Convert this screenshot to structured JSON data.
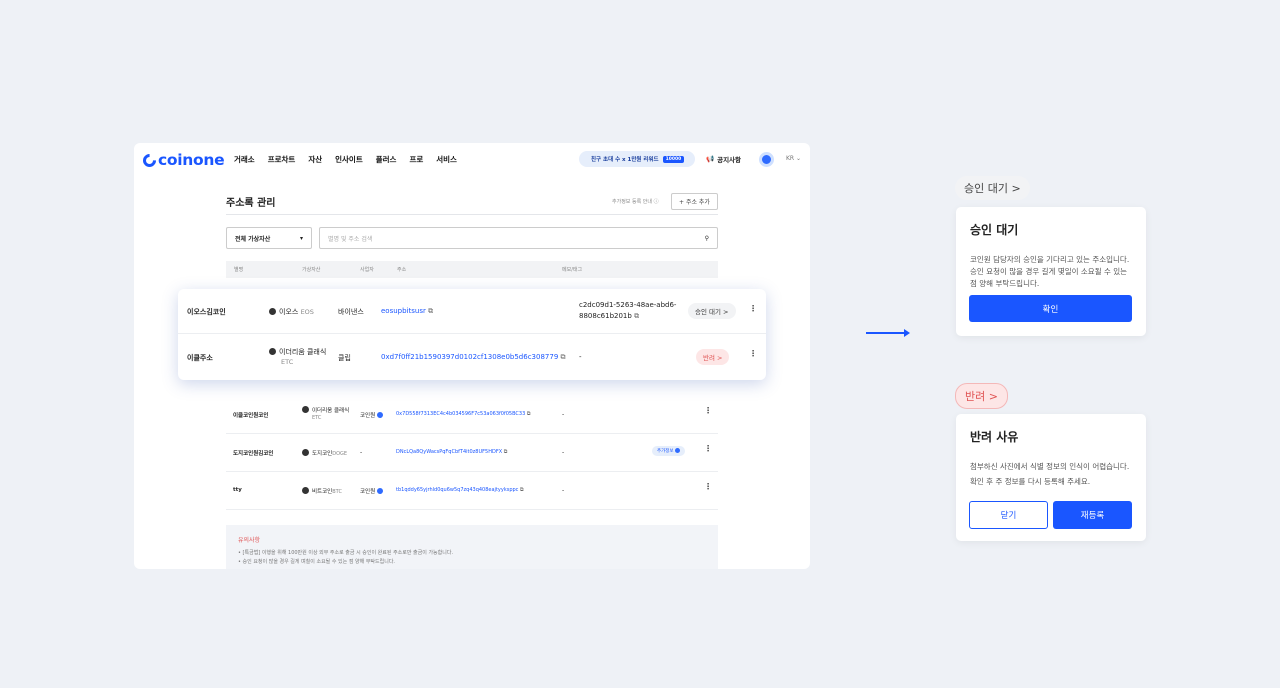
{
  "nav": {
    "brand": "coinone",
    "items": [
      "거래소",
      "프로차트",
      "자산",
      "인사이트",
      "플러스",
      "프로",
      "서비스"
    ],
    "promo": "친구 초대 수 x 1만원 리워드",
    "promo_chip": "10000",
    "notice": "공지사항",
    "lang": "KR"
  },
  "page": {
    "title": "주소록 관리",
    "info": "추가정보 등록 안내",
    "add_button": "+ 주소 추가",
    "filter": "전체 가상자산",
    "search_placeholder": "별명 및 주소 검색",
    "headers": [
      "별명",
      "가상자산",
      "사업자",
      "주소",
      "메모/태그"
    ]
  },
  "highlight_rows": [
    {
      "nickname": "이오스김코인",
      "asset": "이오스",
      "ticker": "EOS",
      "exchange": "바이낸스",
      "address_main": "eosupbits",
      "address_tail": "usr",
      "memo": "c2dc09d1-5263-48ae-abd6-",
      "memo2": "8808c61b201b",
      "status": "승인 대기 >"
    },
    {
      "nickname": "이클주소",
      "asset": "이더리움 클래식",
      "ticker": "ETC",
      "exchange": "클립",
      "address_main": "0xd7f0ff21b1590397d0102cf1308e0b5d6c308",
      "address_tail": "779",
      "memo": "-",
      "status": "반려 >"
    }
  ],
  "rows": [
    {
      "nickname": "이클코인원코인",
      "asset": "이더리움 클래식",
      "ticker": "ETC",
      "exchange": "코인원",
      "address_main": "0x7D558f7313EC4c4b034596F7c53a063f0f05",
      "address_tail": "BC33",
      "memo": "-"
    },
    {
      "nickname": "도지코인원김코인",
      "asset": "도지코인",
      "ticker": "DOGE",
      "exchange": "-",
      "address_main": "DNcLQa8QyWacsPqFqCbfT4it0z8UF5H",
      "address_tail": "DFX",
      "memo": "-",
      "tag": "추가정보"
    },
    {
      "nickname": "tty",
      "asset": "비트코인",
      "ticker": "BTC",
      "exchange": "코인원",
      "address_main": "tb1qddy65yjrhld0qu6w5q7zq43q408eajtyyks",
      "address_tail": "ppc",
      "memo": "-"
    }
  ],
  "notes": {
    "title": "유의사항",
    "lines": [
      "• [특금법] 이행을 위해 100만원 이상 외부 주소로 출금 시 승인이 완료된 주소로만 출금이 가능합니다.",
      "• 승인 요청이 많을 경우 길게 며칠이 소요될 수 있는 점 양해 부탁드립니다."
    ]
  },
  "approval": {
    "chip": "승인 대기 >",
    "title": "승인 대기",
    "body": "코인원 담당자의 승인을 기다리고 있는 주소입니다. 승인 요청이 많을 경우 길게 몇일이 소요될 수 있는 점 양해 부탁드립니다.",
    "confirm": "확인"
  },
  "reject": {
    "chip": "반려 >",
    "title": "반려 사유",
    "body1": "첨부하신 사진에서 식별 정보의 인식이 어렵습니다.",
    "body2": "확인 후 주 정보를 다시 등록해 주세요.",
    "close": "닫기",
    "reregister": "재등록"
  },
  "colors": {
    "accent": "#1a56ff",
    "reject": "#e05252",
    "reject_bg": "#fde6e6"
  }
}
